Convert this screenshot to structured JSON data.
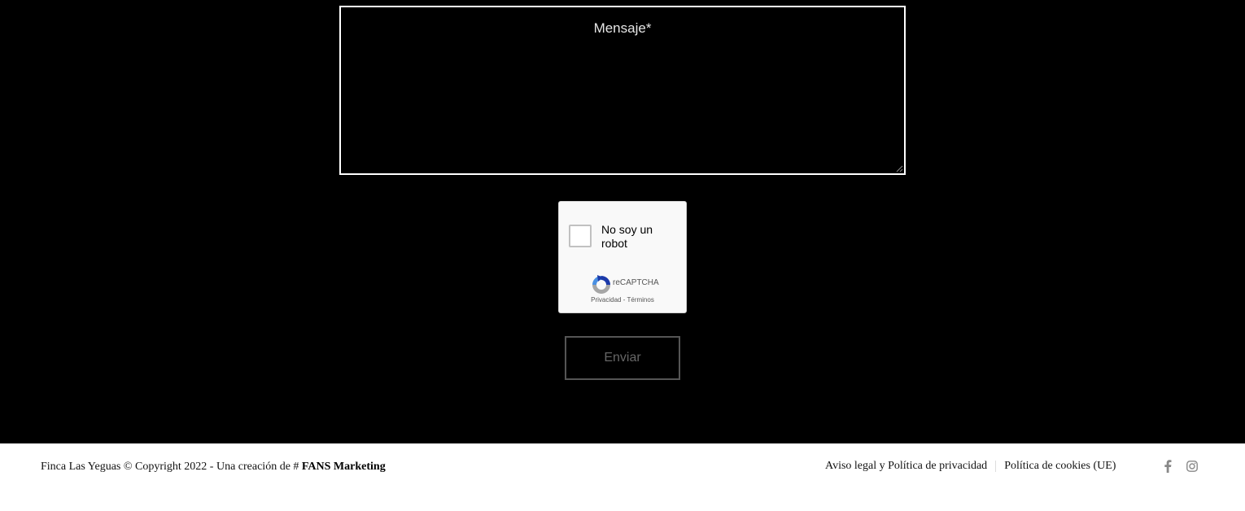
{
  "form": {
    "message_label": "Mensaje*",
    "message_value": "",
    "recaptcha": {
      "label": "No soy un robot",
      "brand": "reCAPTCHA",
      "privacy_link": "Privacidad",
      "separator": " - ",
      "terms_link": "Términos"
    },
    "submit_label": "Enviar"
  },
  "footer": {
    "copyright_text": "Finca Las Yeguas © Copyright 2022 - Una creación de # ",
    "brand_link": "FANS Marketing",
    "links": [
      "Aviso legal y Política de privacidad",
      "Política de cookies (UE)"
    ],
    "social_icons": [
      "facebook-icon",
      "instagram-icon"
    ]
  },
  "colors": {
    "background": "#000000",
    "footer_background": "#ffffff",
    "recaptcha_blue": "#1c3aa9",
    "recaptcha_grey": "#a6a6a6"
  }
}
